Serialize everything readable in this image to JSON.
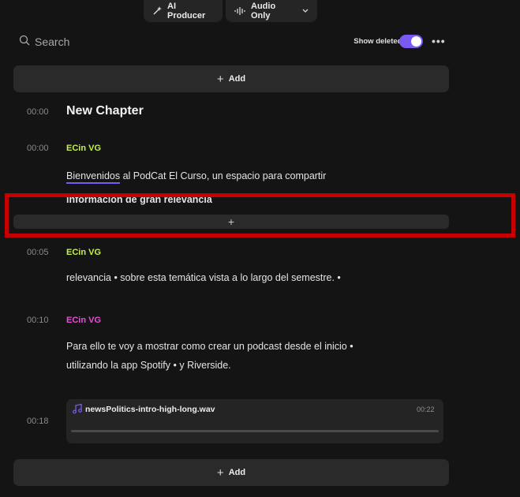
{
  "toolbar": {
    "ai_producer": "AI Producer",
    "audio_only": "Audio Only"
  },
  "search": {
    "label": "Search"
  },
  "show_deleted": {
    "label": "Show deleted text",
    "enabled": true
  },
  "add_label": "Add",
  "chapter": {
    "time": "00:00",
    "title": "New Chapter"
  },
  "segments": [
    {
      "time": "00:00",
      "speaker": "ECin VG",
      "speaker_color": "#c6f04d",
      "word_first": "Bienvenidos",
      "text_rest": " al PodCat El Curso, un espacio para compartir",
      "text_line2": "información de gran relevancia"
    },
    {
      "time": "00:05",
      "speaker": "ECin VG",
      "speaker_color": "#c6f04d",
      "text": "relevancia • sobre esta temática vista a lo largo del semestre. •"
    },
    {
      "time": "00:10",
      "speaker": "ECin VG",
      "speaker_color": "#e84fd8",
      "text_line1": "Para ello te voy a mostrar como crear un podcast desde el inicio •",
      "text_line2": "utilizando la app Spotify • y Riverside."
    }
  ],
  "audio_clip": {
    "time": "00:18",
    "filename": "newsPolitics-intro-high-long.wav",
    "duration": "00:22"
  },
  "colors": {
    "accent": "#7a5af5",
    "highlight": "#c40000"
  }
}
